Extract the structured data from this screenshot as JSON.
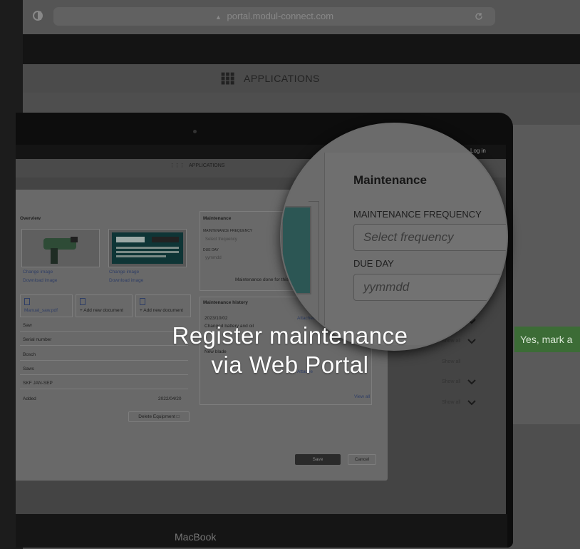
{
  "colors": {
    "accent_link": "#2f3e66",
    "confirm_button": "#3c6c36",
    "overlay_text": "#ffffff"
  },
  "background_browser": {
    "url": "portal.modul-connect.com",
    "lock_icon": "lock-icon",
    "reload_icon": "reload-icon",
    "apps_label": "APPLICATIONS",
    "confirm_button": "Yes, mark a"
  },
  "screen": {
    "login": "Log in",
    "apps_label": "APPLICATIONS",
    "brand": "MacBook"
  },
  "overview": {
    "title": "Overview",
    "change_image": "Change image",
    "download_image": "Download image",
    "documents": [
      {
        "label": "Manual_saw.pdf"
      },
      {
        "label": "+ Add new document"
      },
      {
        "label": "+ Add new document"
      }
    ],
    "fields": [
      "Saw",
      "Serial number",
      "Bosch",
      "Saws",
      "SKF JAN-SEP"
    ],
    "added_label": "Added",
    "added_value": "2022/04/20",
    "delete_button": "Delete Equipment"
  },
  "maintenance_small": {
    "title": "Maintenance",
    "freq_label": "MAINTENANCE FREQUENCY",
    "freq_placeholder": "Select frequency",
    "due_label": "DUE DAY",
    "due_placeholder": "yymmdd",
    "done_button": "Maintenance done for this"
  },
  "history": {
    "title": "Maintenance history",
    "entries": [
      {
        "date": "2023/10/02",
        "text": "Changed battery and oil",
        "attached": "Attached docu"
      },
      {
        "date": "",
        "text": "New blade",
        "attached": ""
      }
    ],
    "attached2": "Attache",
    "view_all": "View all"
  },
  "show_all_label": "Show all",
  "modal_buttons": {
    "save": "Save",
    "cancel": "Cancel"
  },
  "magnifier": {
    "title": "Maintenance",
    "freq_label": "MAINTENANCE FREQUENCY",
    "freq_placeholder": "Select frequency",
    "due_label": "DUE DAY",
    "due_placeholder": "yymmdd"
  },
  "caption": {
    "line1": "Register maintenance",
    "line2": "via Web Portal"
  }
}
